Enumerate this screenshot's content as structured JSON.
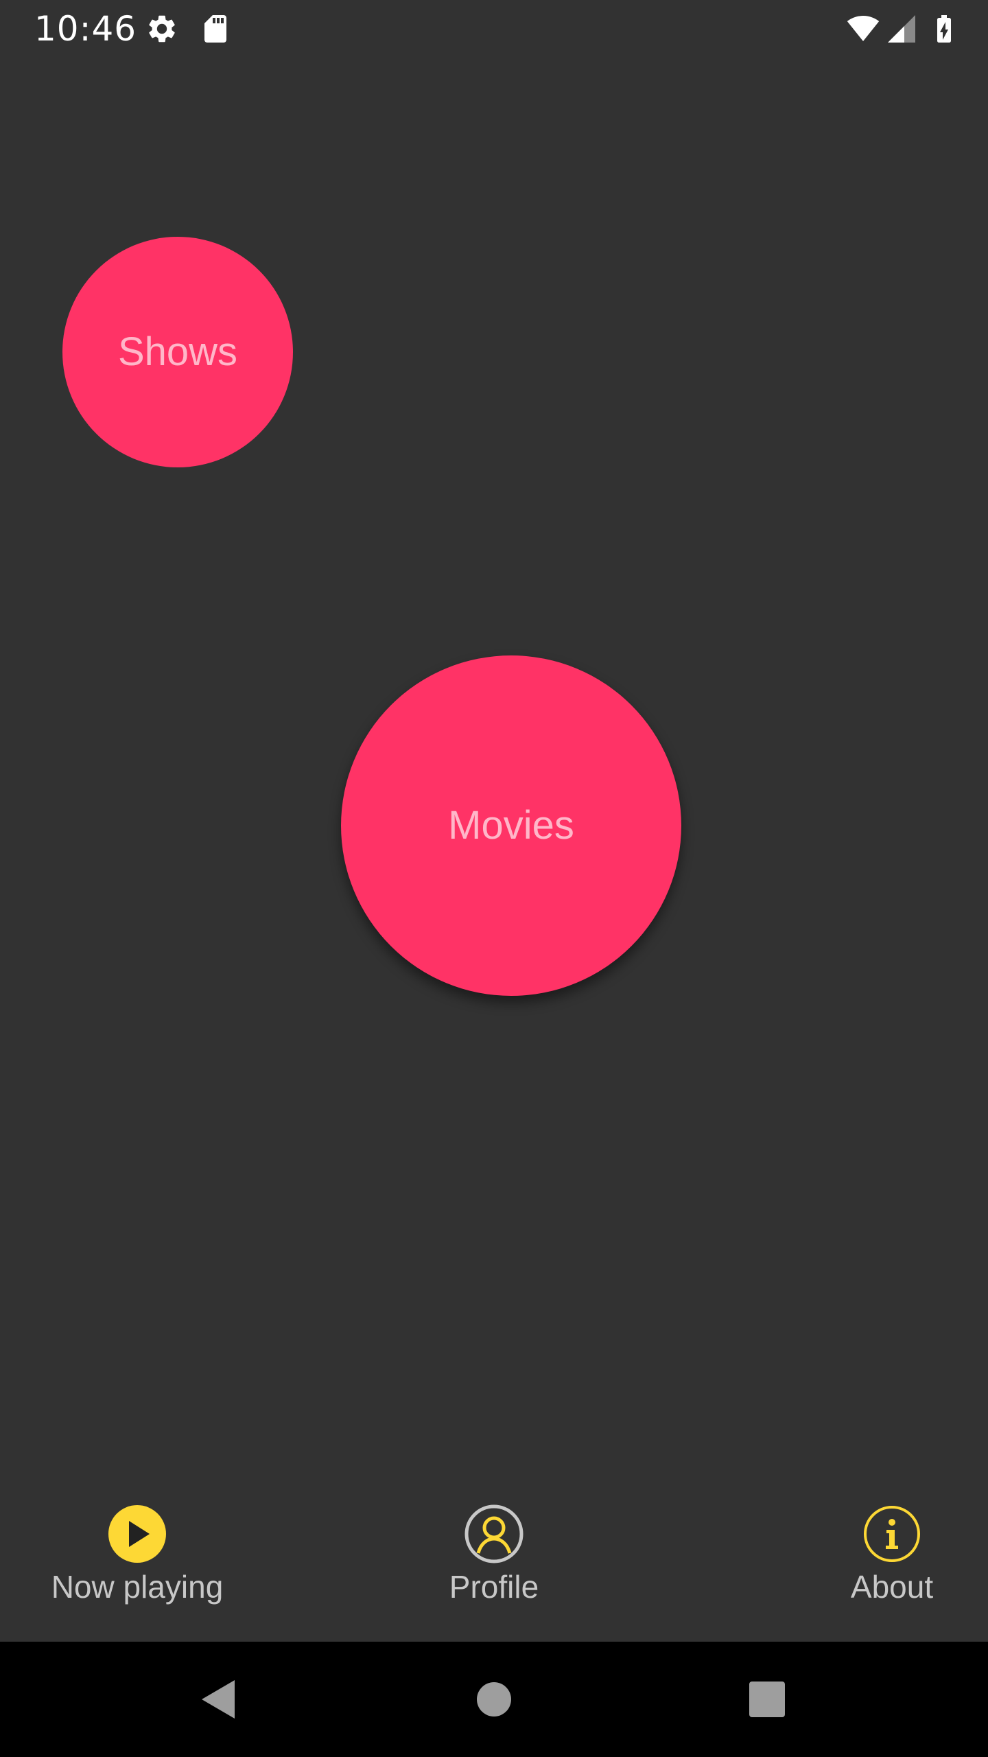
{
  "status_bar": {
    "time": "10:46",
    "icons": [
      "settings-icon",
      "sd-card-icon",
      "wifi-icon",
      "cell-signal-icon",
      "battery-charging-icon"
    ]
  },
  "bubbles": {
    "shows": {
      "label": "Shows",
      "color": "#ff3366"
    },
    "movies": {
      "label": "Movies",
      "color": "#ff3366"
    }
  },
  "bottom_nav": {
    "accent_color": "#fdd835",
    "items": [
      {
        "label": "Now playing",
        "icon": "play-circle-icon"
      },
      {
        "label": "Profile",
        "icon": "profile-icon"
      },
      {
        "label": "About",
        "icon": "info-icon"
      }
    ]
  },
  "system_nav": {
    "buttons": [
      "back-icon",
      "home-icon",
      "recents-icon"
    ]
  }
}
